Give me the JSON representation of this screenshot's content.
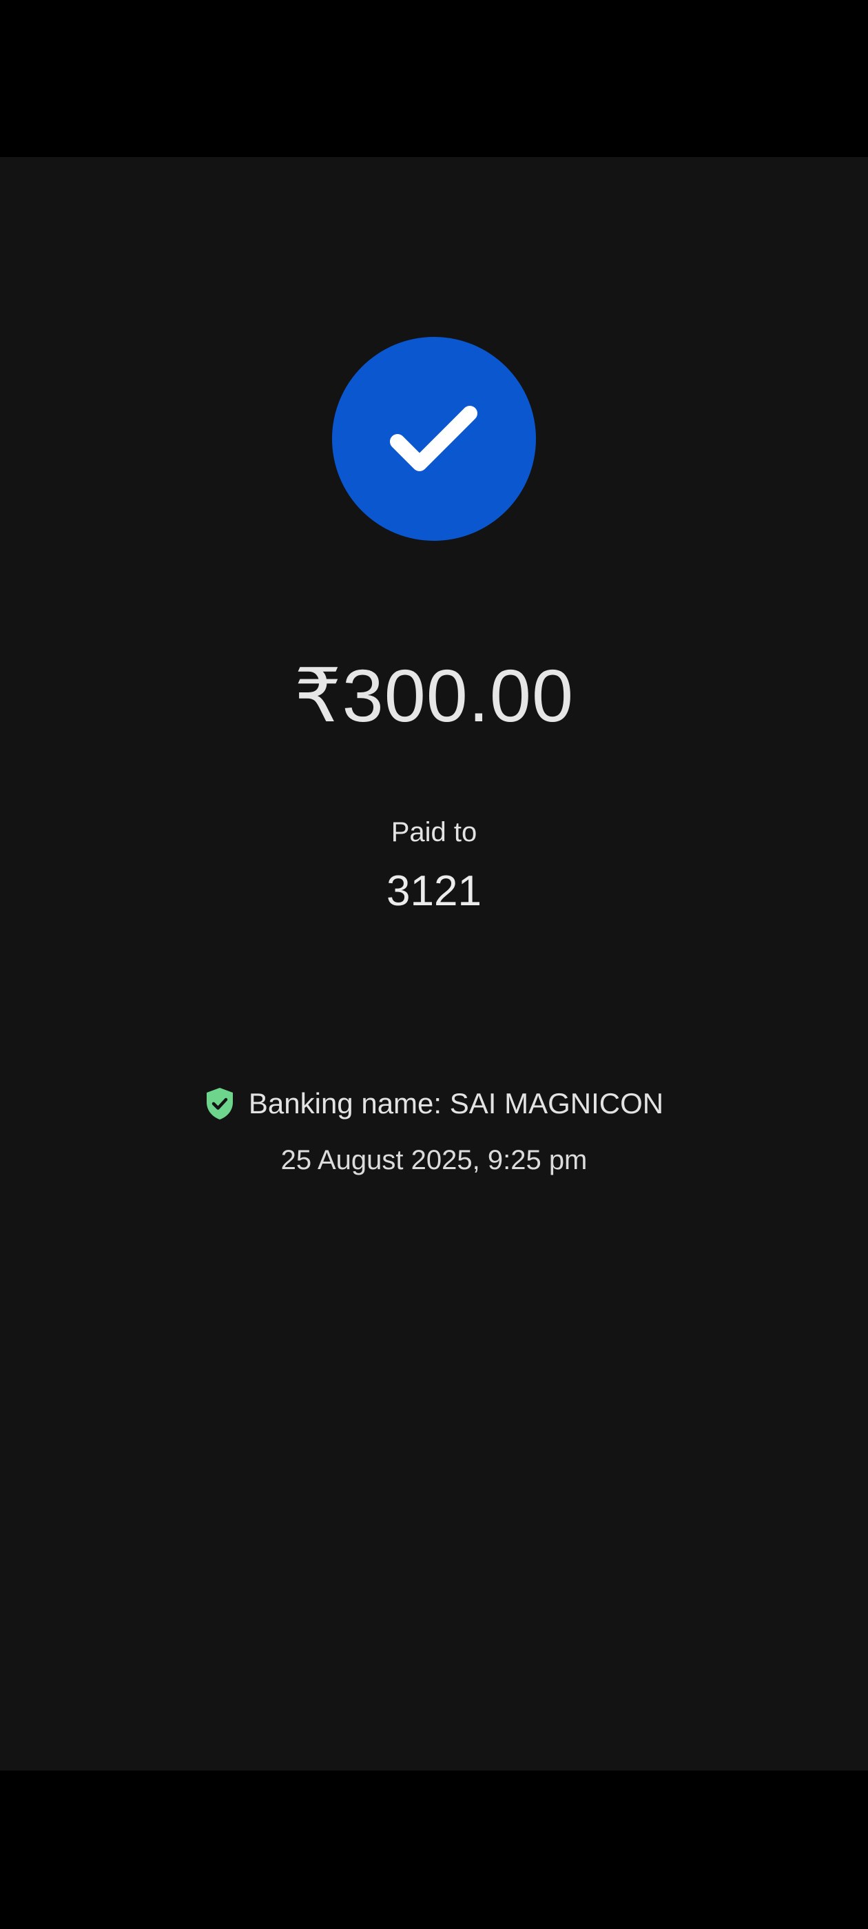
{
  "payment": {
    "amount": "₹300.00",
    "paid_to_label": "Paid to",
    "payee": "3121",
    "banking_name": "Banking name: SAI MAGNICON",
    "timestamp": "25 August 2025, 9:25 pm"
  },
  "icons": {
    "status": "check-icon",
    "verified": "shield-check-icon"
  },
  "colors": {
    "accent": "#0b57d0",
    "verified": "#6dd58c",
    "background": "#131313"
  }
}
